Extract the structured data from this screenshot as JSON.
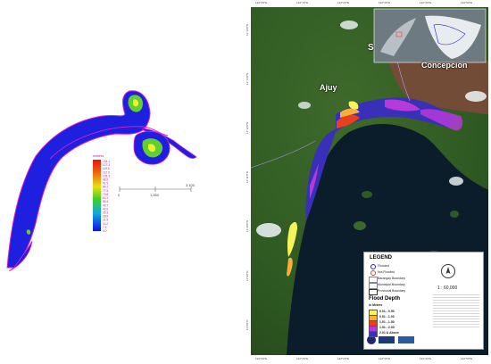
{
  "left": {
    "colorbar": {
      "title": "meters",
      "labels": [
        "134.1",
        "127.3",
        "119.6",
        "112.0",
        "105.3",
        "98.6",
        "91.9",
        "84.2",
        "77.5",
        "70.8",
        "63.1",
        "56.4",
        "49.7",
        "42.0",
        "35.3",
        "28.6",
        "21.9",
        "14.2",
        "7.5",
        "0.0"
      ]
    },
    "scalebar": {
      "labels": [
        "0",
        "1,550",
        "3,100"
      ]
    }
  },
  "right": {
    "places": {
      "ajuy": "Ajuy",
      "concepcion": "Concepcion",
      "partial": "S"
    },
    "top_ticks": [
      "122°0'0\"E",
      "122°1'0\"E",
      "122°2'0\"E",
      "122°3'0\"E",
      "122°4'0\"E",
      "122°5'0\"E"
    ],
    "bottom_ticks": [
      "122°0'0\"E",
      "122°1'0\"E",
      "122°2'0\"E",
      "122°3'0\"E",
      "122°4'0\"E",
      "122°5'0\"E"
    ],
    "left_ticks": [
      "11°14'0\"N",
      "11°13'0\"N",
      "11°12'0\"N",
      "11°11'0\"N",
      "11°10'0\"N",
      "11°9'0\"N",
      "11°8'0\"N"
    ],
    "legend": {
      "title": "LEGEND",
      "symbols": [
        "Flooded",
        "Not Flooded",
        "Barangay Boundary",
        "Municipal Boundary",
        "Provincial Boundary"
      ],
      "depth_title": "Flood Depth",
      "depth_unit": "in Meters",
      "classes": [
        {
          "label": "0.01 - 0.50",
          "color": "#f7f35a"
        },
        {
          "label": "0.51 - 1.00",
          "color": "#f6b13c"
        },
        {
          "label": "1.01 - 1.50",
          "color": "#e8401c"
        },
        {
          "label": "1.51 - 2.00",
          "color": "#b63ad8"
        },
        {
          "label": "2.01 & Above",
          "color": "#3a2fb8"
        }
      ],
      "scale": "1 : 60,000"
    }
  },
  "colors": {
    "dem_water": "#1f1fe0",
    "dem_outline": "#e020c8",
    "flood_blue": "#3a2fb8",
    "flood_purple": "#b63ad8",
    "flood_red": "#e8401c",
    "flood_orange": "#f6b13c",
    "flood_yellow": "#f7f35a",
    "sea": "#0a1a2a"
  }
}
